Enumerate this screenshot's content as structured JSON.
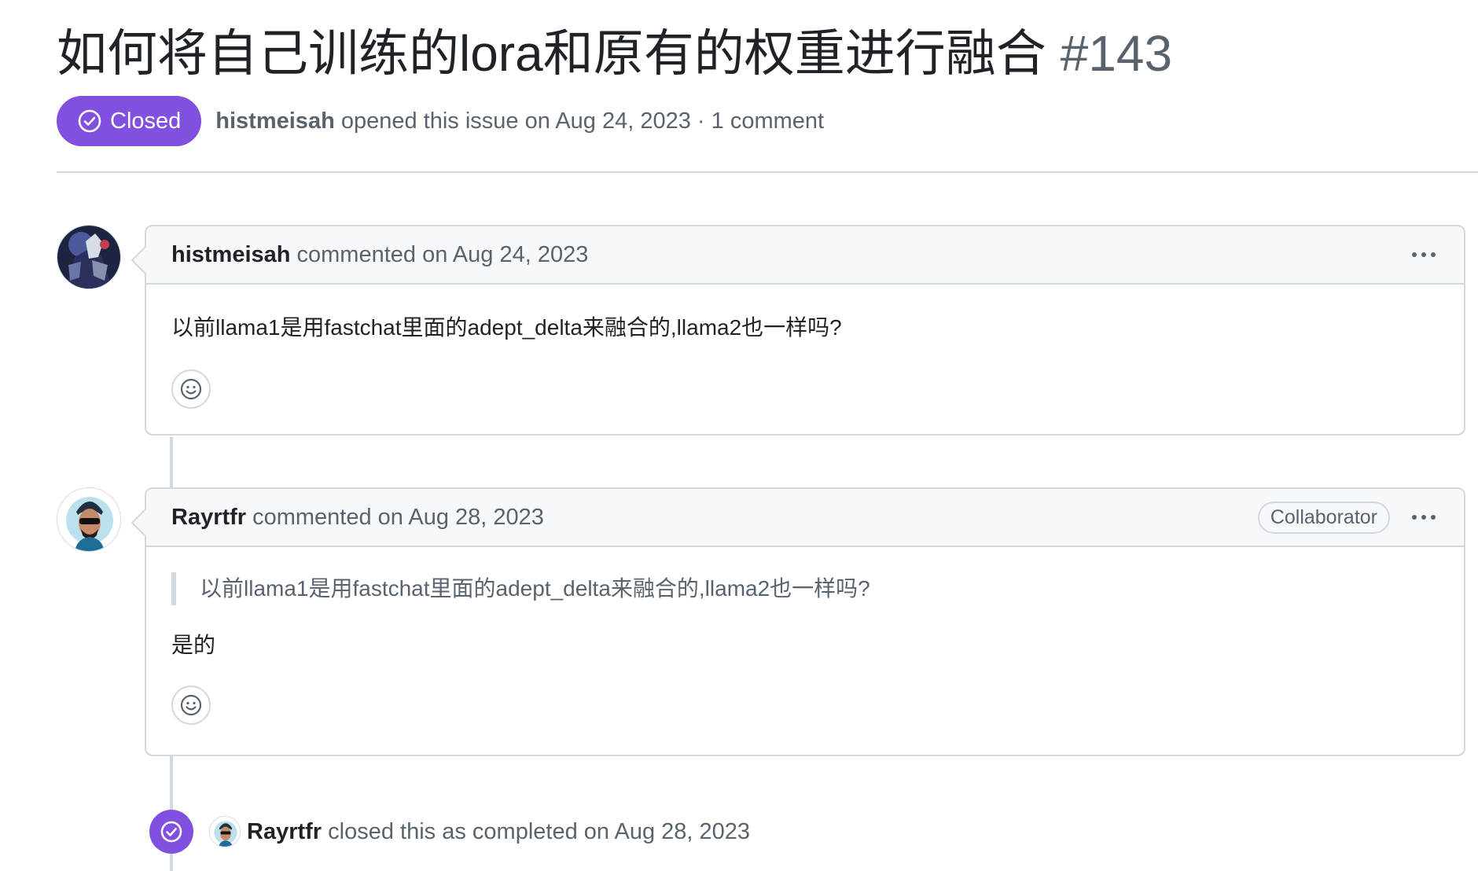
{
  "issue": {
    "title": "如何将自己训练的lora和原有的权重进行融合",
    "number": "#143",
    "state": "Closed",
    "author": "histmeisah",
    "opened_text": "opened this issue on Aug 24, 2023 · 1 comment",
    "state_color": "#8250df"
  },
  "comments": [
    {
      "author": "histmeisah",
      "meta": "commented on Aug 24, 2023",
      "body": "以前llama1是用fastchat里面的adept_delta来融合的,llama2也一样吗?",
      "icon": "smiley-icon"
    },
    {
      "author": "Rayrtfr",
      "meta": "commented on Aug 28, 2023",
      "role": "Collaborator",
      "quote": "以前llama1是用fastchat里面的adept_delta来融合的,llama2也一样吗?",
      "body": "是的",
      "icon": "smiley-icon"
    }
  ],
  "event": {
    "author": "Rayrtfr",
    "text": "closed this as completed on Aug 28, 2023",
    "icon": "check-circle-icon"
  }
}
